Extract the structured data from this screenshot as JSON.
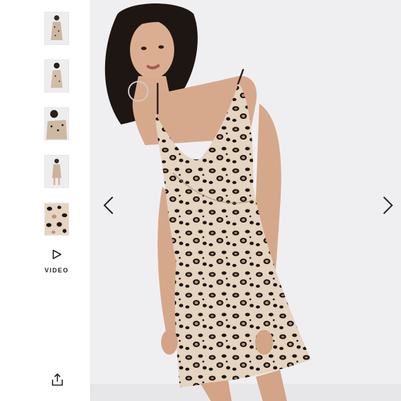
{
  "gallery": {
    "thumbnails": [
      {
        "alt_icon": "model-front-thumbnail"
      },
      {
        "alt_icon": "model-back-thumbnail"
      },
      {
        "alt_icon": "model-closeup-thumbnail"
      },
      {
        "alt_icon": "model-side-thumbnail"
      },
      {
        "alt_icon": "fabric-detail-thumbnail"
      }
    ],
    "video_label": "VIDEO",
    "share_icon": "share-icon"
  },
  "viewer": {
    "prev_icon": "chevron-left-icon",
    "next_icon": "chevron-right-icon",
    "image_subject": "leopard-print-wrap-mini-dress"
  },
  "colors": {
    "background": "#efeff1",
    "print_base": "#e4d4c0",
    "print_spot": "#1c1712",
    "print_accent": "#c48f7e"
  }
}
